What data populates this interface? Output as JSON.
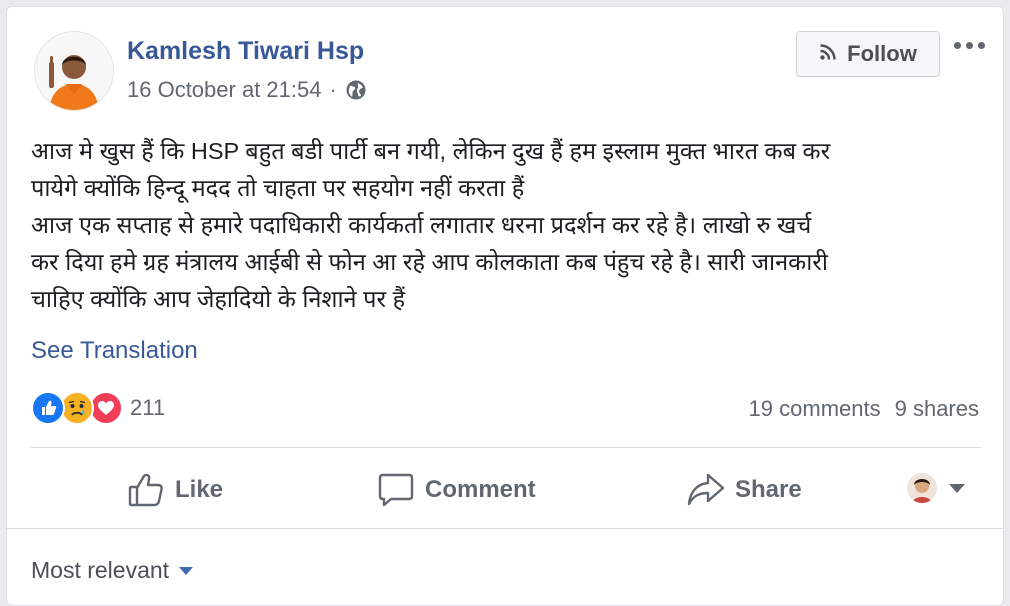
{
  "post": {
    "author": "Kamlesh Tiwari Hsp",
    "timestamp": "16 October at 21:54",
    "separator": "·",
    "privacy_icon": "globe-icon",
    "follow_label": "Follow",
    "body_lines": [
      "आज मे खुस हैं कि HSP बहुत बडी पार्टी बन गयी, लेकिन दुख हैं हम इस्लाम मुक्त भारत कब कर",
      "पायेगे क्योंकि हिन्दू मदद तो चाहता पर सहयोग नहीं करता हैं",
      "आज एक सप्ताह से हमारे पदाधिकारी कार्यकर्ता लगातार धरना प्रदर्शन कर रहे है। लाखो रु खर्च",
      "कर दिया हमे ग्रह मंत्रालय आईबी से फोन आ रहे आप कोलकाता कब पंहुच रहे है। सारी जानकारी",
      "चाहिए क्योंकि आप जेहादियो के निशाने पर हैं"
    ],
    "see_translation": "See Translation"
  },
  "reactions": {
    "types": [
      "like",
      "sad",
      "love"
    ],
    "count": "211"
  },
  "stats": {
    "comments": "19 comments",
    "shares": "9 shares"
  },
  "actions": {
    "like": "Like",
    "comment": "Comment",
    "share": "Share"
  },
  "comments": {
    "sort_label": "Most relevant"
  },
  "colors": {
    "link": "#385898",
    "like_blue": "#1877f2",
    "love_red": "#f33e58",
    "sad_yellow": "#f7b125",
    "muted": "#606770"
  }
}
